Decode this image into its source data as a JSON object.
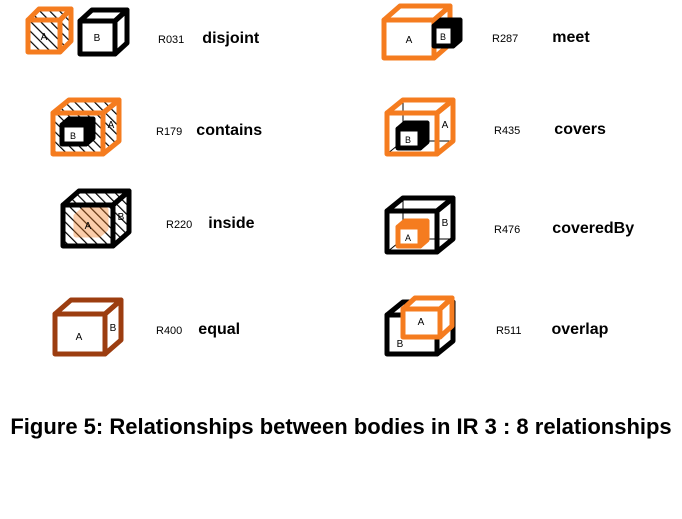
{
  "figure": {
    "caption": "Figure 5: Relationships between bodies in IR 3 : 8 relationships",
    "colors": {
      "accent_orange": "#F57C1F",
      "black": "#000000",
      "dark_brown": "#9C3D10",
      "background": "#FFFFFF"
    },
    "relationships": [
      {
        "code": "R031",
        "name": "disjoint",
        "labels": {
          "a": "A",
          "b": "B"
        },
        "glyph": "two-separate-cubes-a-orange-hatched-b-black",
        "a_color": "#F57C1F",
        "b_color": "#000000"
      },
      {
        "code": "R287",
        "name": "meet",
        "labels": {
          "a": "A",
          "b": "B"
        },
        "glyph": "large-orange-cube-touching-small-black-cube",
        "a_color": "#F57C1F",
        "b_color": "#000000"
      },
      {
        "code": "R179",
        "name": "contains",
        "labels": {
          "a": "A",
          "b": "B"
        },
        "glyph": "orange-hatched-cube-containing-small-black-cube",
        "a_color": "#F57C1F",
        "b_color": "#000000"
      },
      {
        "code": "R435",
        "name": "covers",
        "labels": {
          "a": "A",
          "b": "B"
        },
        "glyph": "orange-wireframe-cube-with-small-black-cube-touching-face",
        "a_color": "#F57C1F",
        "b_color": "#000000"
      },
      {
        "code": "R220",
        "name": "inside",
        "labels": {
          "a": "A",
          "b": "B"
        },
        "glyph": "black-hatched-cube-containing-orange-blob",
        "a_color": "#F57C1F",
        "b_color": "#000000"
      },
      {
        "code": "R476",
        "name": "coveredBy",
        "labels": {
          "a": "A",
          "b": "B"
        },
        "glyph": "black-wireframe-cube-with-small-orange-cube-touching-face",
        "a_color": "#F57C1F",
        "b_color": "#000000"
      },
      {
        "code": "R400",
        "name": "equal",
        "labels": {
          "a": "A",
          "b": "B"
        },
        "glyph": "single-dark-brown-cube-coincident",
        "a_color": "#9C3D10",
        "b_color": "#9C3D10"
      },
      {
        "code": "R511",
        "name": "overlap",
        "labels": {
          "a": "A",
          "b": "B"
        },
        "glyph": "orange-cube-overlapping-black-cube",
        "a_color": "#F57C1F",
        "b_color": "#000000"
      }
    ]
  }
}
